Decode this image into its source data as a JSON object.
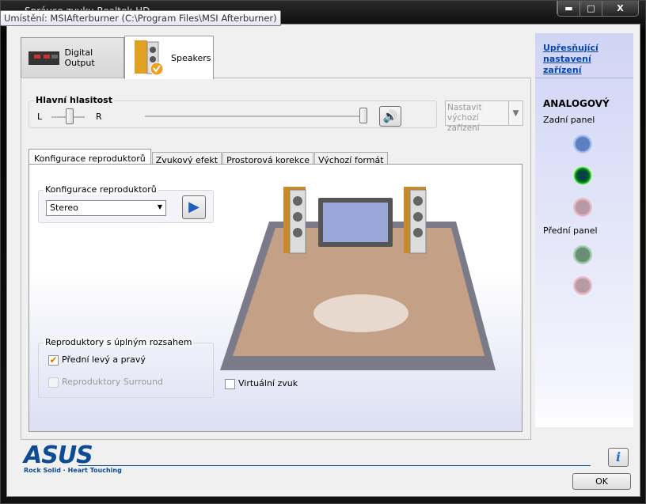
{
  "window": {
    "title": "Správce zvuku Realtek HD",
    "minimize": "▬",
    "maximize": "□",
    "close": "X"
  },
  "tooltip": "Umístění: MSIAfterburner (C:\\Program Files\\MSI Afterburner)",
  "device_tabs": [
    {
      "label": "Digital Output",
      "active": false
    },
    {
      "label": "Speakers",
      "active": true
    }
  ],
  "advanced_link": "Upřesňující nastavení zařízení",
  "connectors": {
    "heading": "ANALOGOVÝ",
    "rear_label": "Zadní panel",
    "front_label": "Přední panel",
    "rear_colors": [
      "#6f8fd0",
      "#0a7a1a",
      "#d9a9b4"
    ],
    "front_colors": [
      "#7ab08a",
      "#d9a9b4"
    ]
  },
  "volume": {
    "label": "Hlavní hlasitost",
    "left": "L",
    "right": "R",
    "balance": 0.5,
    "level": 1.0
  },
  "default_device": {
    "label": "Nastavit výchozí zařízení"
  },
  "sub_tabs": [
    "Konfigurace reproduktorů",
    "Zvukový efekt",
    "Prostorová korekce",
    "Výchozí formát"
  ],
  "speaker_config": {
    "group_label": "Konfigurace reproduktorů",
    "selected": "Stereo"
  },
  "fullrange": {
    "group_label": "Reproduktory s úplným rozsahem",
    "front": {
      "label": "Přední levý a pravý",
      "checked": true
    },
    "surround": {
      "label": "Reproduktory Surround",
      "checked": false,
      "disabled": true
    }
  },
  "virtual": {
    "label": "Virtuální zvuk",
    "checked": false
  },
  "brand": {
    "logo": "ASUS",
    "tagline": "Rock Solid · Heart Touching"
  },
  "ok": "OK",
  "info_icon": "i"
}
